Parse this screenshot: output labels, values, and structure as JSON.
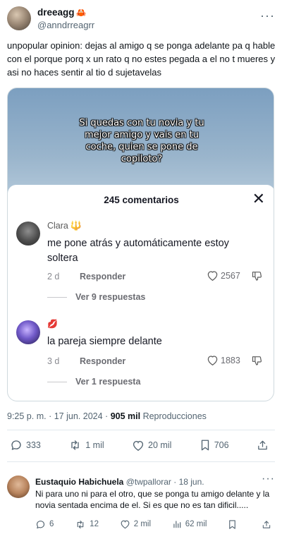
{
  "author": {
    "display_name": "dreeagg",
    "badge_emoji": "🦀",
    "handle": "@anndrreagrr"
  },
  "post": {
    "text": "unpopular opinion: dejas al amigo q se ponga adelante pa q hable con el porque porq x un rato q no estes pegada a el no t mueres y asi no haces sentir al tio d sujetavelas"
  },
  "media": {
    "overlay_text": "Si quedas con tu novia y tu mejor amigo y vais en tu coche, quien se pone de copiloto?",
    "sheet_title": "245 comentarios",
    "comments": [
      {
        "user": "Clara",
        "user_emoji": "🔱",
        "text": "me pone atrás y automáticamente estoy soltera",
        "date": "2 d",
        "reply_label": "Responder",
        "likes": "2567",
        "view_replies": "Ver 9 respuestas"
      },
      {
        "user": "",
        "user_emoji": "💋",
        "text": "la pareja siempre delante",
        "date": "3 d",
        "reply_label": "Responder",
        "likes": "1883",
        "view_replies": "Ver 1 respuesta"
      }
    ]
  },
  "meta": {
    "time": "9:25 p. m.",
    "separator": "·",
    "date": "17 jun. 2024",
    "views": "905 mil",
    "views_label": "Reproducciones"
  },
  "actions": {
    "replies": "333",
    "reposts": "1 mil",
    "likes": "20 mil",
    "bookmarks": "706"
  },
  "reply": {
    "name": "Eustaquio Habichuela",
    "handle": "@twpallorar",
    "date": "· 18 jun.",
    "text": "Ni para uno ni para el otro, que se ponga tu amigo delante y la novia sentada encima de el. Si es que no es tan dificil.....",
    "replies": "6",
    "reposts": "12",
    "likes": "2 mil",
    "views": "62 mil"
  },
  "colors": {
    "text": "#0f1419",
    "muted": "#536471",
    "divider": "#e1e8ed"
  }
}
